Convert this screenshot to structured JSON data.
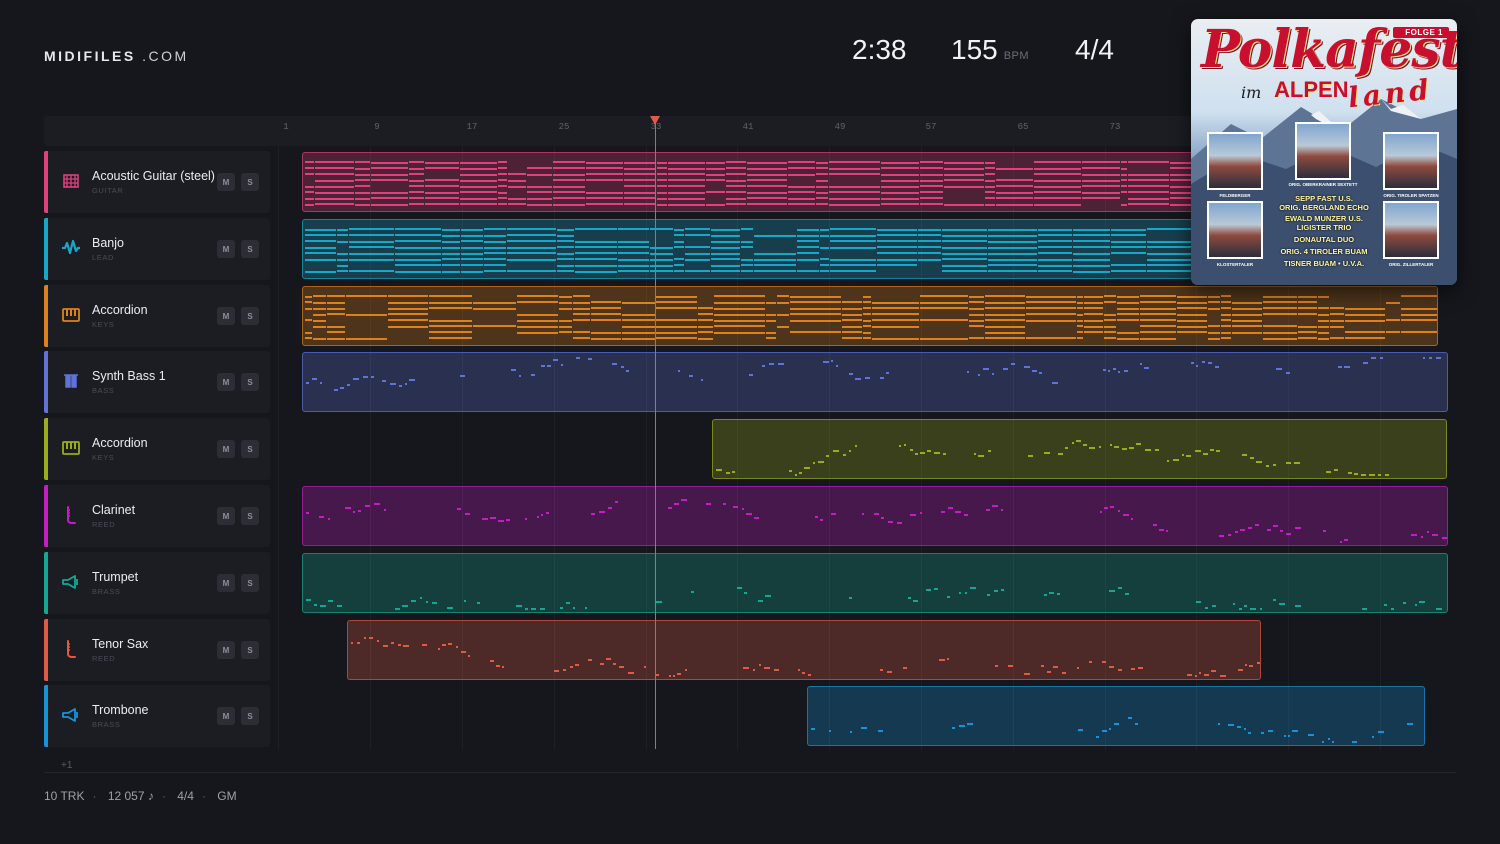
{
  "brand": {
    "name": "MIDIFILES",
    "suffix": ".COM"
  },
  "header": {
    "duration": "2:38",
    "tempo": "155",
    "tempo_unit": "BPM",
    "time_signature": "4/4"
  },
  "ruler": {
    "bars": [
      "1",
      "9",
      "17",
      "25",
      "33",
      "41",
      "49",
      "57",
      "65",
      "73"
    ]
  },
  "tracks": [
    {
      "name": "Acoustic Guitar (steel)",
      "category": "GUITAR",
      "icon": "guitar-icon",
      "color": "#e0407e",
      "mute": "M",
      "solo": "S"
    },
    {
      "name": "Banjo",
      "category": "LEAD",
      "icon": "waveform-icon",
      "color": "#19a7c9",
      "mute": "M",
      "solo": "S"
    },
    {
      "name": "Accordion",
      "category": "KEYS",
      "icon": "keys-icon",
      "color": "#e0801a",
      "mute": "M",
      "solo": "S"
    },
    {
      "name": "Synth Bass 1",
      "category": "BASS",
      "icon": "bass-icon",
      "color": "#5f73d8",
      "mute": "M",
      "solo": "S"
    },
    {
      "name": "Accordion",
      "category": "KEYS",
      "icon": "keys-icon",
      "color": "#9aad1a",
      "mute": "M",
      "solo": "S"
    },
    {
      "name": "Clarinet",
      "category": "REED",
      "icon": "reed-icon",
      "color": "#c41dc4",
      "mute": "M",
      "solo": "S"
    },
    {
      "name": "Trumpet",
      "category": "BRASS",
      "icon": "brass-icon",
      "color": "#14a894",
      "mute": "M",
      "solo": "S"
    },
    {
      "name": "Tenor Sax",
      "category": "REED",
      "icon": "reed-icon",
      "color": "#e05a44",
      "mute": "M",
      "solo": "S"
    },
    {
      "name": "Trombone",
      "category": "BRASS",
      "icon": "brass-icon",
      "color": "#1793dc",
      "mute": "M",
      "solo": "S"
    }
  ],
  "more_tracks": "+1",
  "footer": {
    "tracks": "10 TRK",
    "notes": "12 057 ♪",
    "time_signature": "4/4",
    "standard": "GM"
  },
  "cover": {
    "badge": "FOLGE 1",
    "title": "Polkafest",
    "subtitle_im": "im",
    "subtitle_alpen": "ALPEN",
    "subtitle_land": "land",
    "photos": [
      "FELDBERGER",
      "ORIG. OBERKRAINER SEXTETT",
      "ORIG. TIROLER SPATZEN",
      "KLOSTERTALER",
      "ORIG. ZILLERTALER"
    ],
    "artists": [
      "SEPP FAST U.S.",
      "ORIG. BERGLAND ECHO",
      "EWALD MUNZER U.S.",
      "LIGISTER TRIO",
      "DONAUTAL DUO",
      "ORIG. 4 TIROLER BUAM",
      "TISNER BUAM • U.V.A."
    ]
  }
}
